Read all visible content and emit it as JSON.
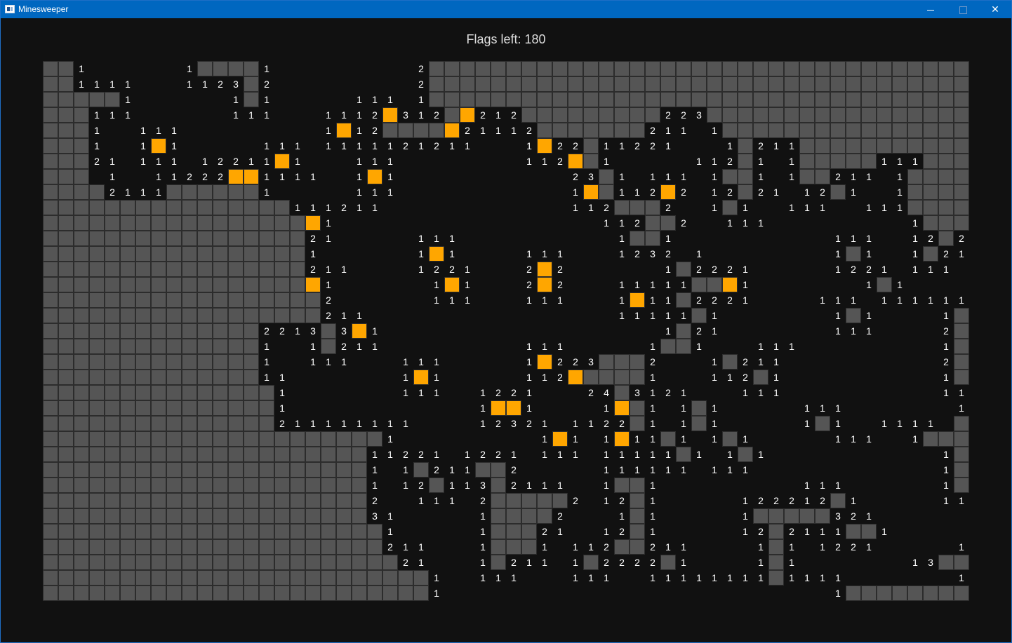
{
  "window": {
    "title": "Minesweeper",
    "controls": {
      "minimize": "minimize-icon",
      "maximize": "maximize-icon",
      "close": "close-icon"
    }
  },
  "status": {
    "flags_label": "Flags left: 180"
  },
  "board": {
    "columns": 60,
    "rows": 35,
    "legend": {
      "#": "hidden-cell",
      "F": "flagged-cell",
      ".": "revealed-empty",
      "1-8": "revealed-number"
    },
    "colors": {
      "hidden": "#555555",
      "flag": "#ffa600",
      "number": "#ffffff",
      "background": "#111111",
      "grid_line": "#2c2c2c"
    },
    "grid": [
      "##1......1####1.........2###################################",
      "##1111...1123#2.........2###################################",
      "#####1......1#1.....111.1###################################",
      "###111......111...1112F312#F212#########223#################",
      "###1..111.........1F12####F21112#######211.1################",
      "###1..1F1.....111.1111121211...1F22#11221...1#211###########",
      "###21.111.12211F1...111........112F#1.....112#1.1#####111###",
      "###.1..11222FF1111..1F1...........23#1.111.1##1.1##211.1####",
      "####2111######1.....111...........1F#112F2.12#21.12#1..1####",
      "################111211............112###2..1#1..111..111####",
      "#################F1.................112##2..111.........1####",
      "#################21.....111..........1##1..........111..12#21",
      "#################1......1F1....111...1232.1........1#1..1#21.",
      "#################211....1221...2F2......1#2221.....1221.111..",
      "#################F1......1F1...2F2...11111##F1.......1#1.....",
      "##################2......111...111...1F11#2221....111.111111.",
      "##################211................11111#1.......1#1....1#211",
      "##############2213#3F1..................1#21.......111....2##2.",
      "##############1..1#211.........111.....1##1...111.........1##2.",
      "##############1..111...111.....1F223###2...1#211..........2##1.",
      "##############11.......1F1.....112F####1...112#1..........1##11",
      "###############1.......111..1221...24#3121...111..........112##",
      "###############1............1FF1....1F#1.1#1.....111.......1##",
      "###############211111111....12321.1122#1.1#1.....1#1..1111.###",
      "######################1.........1F1.1F11#1.1#1.....111..1######",
      "#####################11221.1221.111.11111#1.1#1...........1####",
      "#####################1.1#211##2.....111111.111............1####",
      "#####################1.12#113#2111..1##1.........111......1####",
      "#####################2..111.2#####2.12#1.....122212#1.....1111##",
      "#####################31.....1####2...1#1.....1#####321.......1##",
      "######################1.....1###21..12#1.....12#2111##1......1##",
      "######################211...1###1.112##211....1#1.1221.....11###",
      "#######################21...1#211.1#2222#1....1#1.......13######",
      "#########################1..111...111..11111111#1111.......1####",
      "#########################1.........................1########1..1####"
    ]
  }
}
